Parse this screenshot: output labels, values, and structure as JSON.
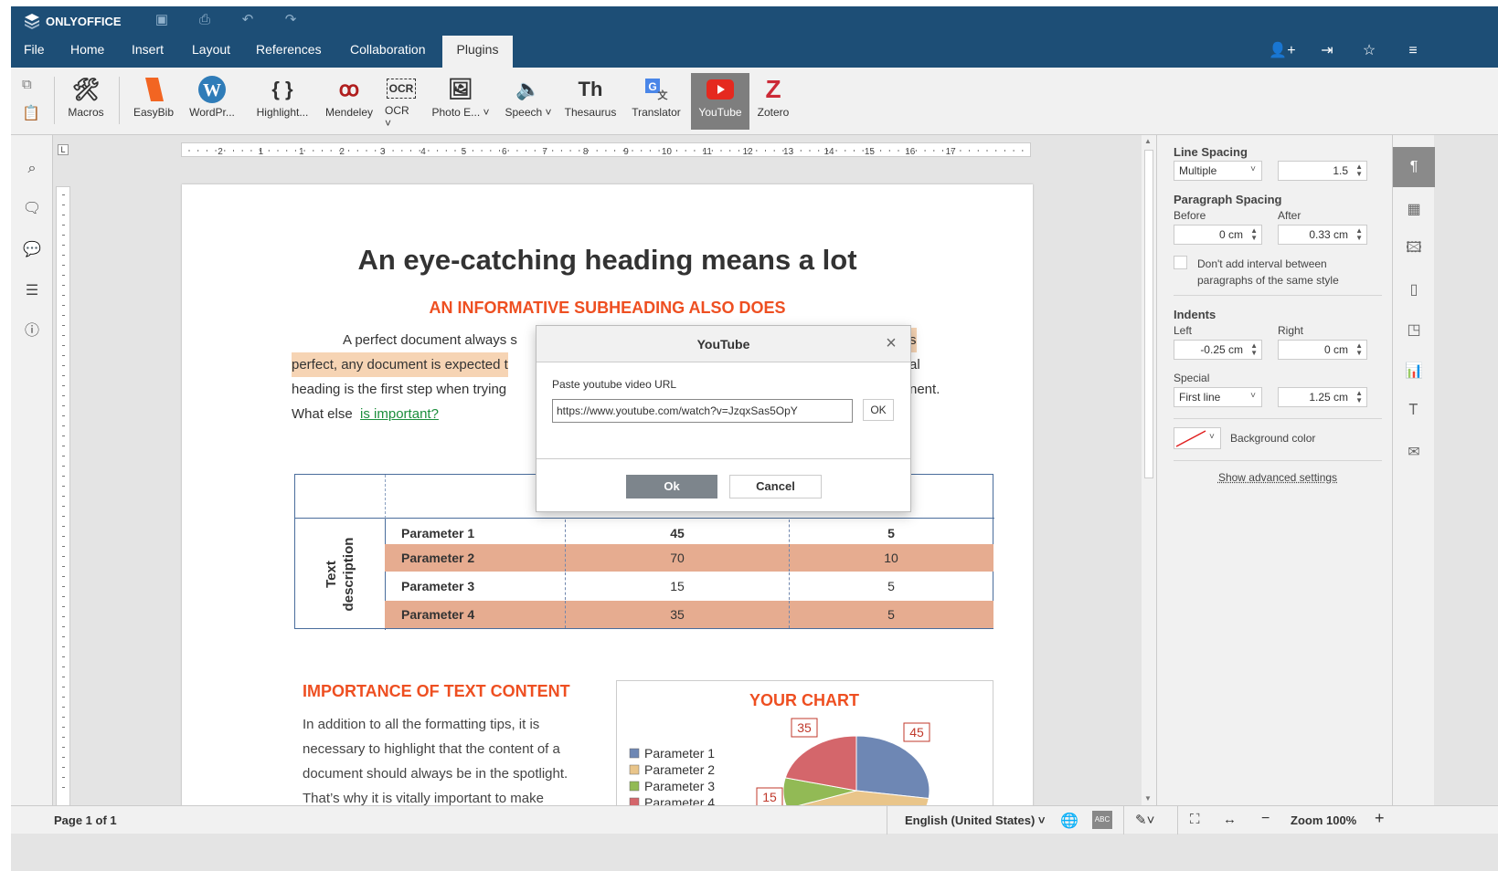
{
  "app": {
    "brand": "ONLYOFFICE"
  },
  "menu": {
    "tabs": [
      "File",
      "Home",
      "Insert",
      "Layout",
      "References",
      "Collaboration",
      "Plugins"
    ],
    "active": "Plugins"
  },
  "ribbon": {
    "items": [
      {
        "label": "Macros",
        "icon": "macros-icon"
      },
      {
        "label": "EasyBib",
        "icon": "easybib-icon"
      },
      {
        "label": "WordPr...",
        "icon": "wordpress-icon"
      },
      {
        "label": "Highlight...",
        "icon": "code-braces-icon"
      },
      {
        "label": "Mendeley",
        "icon": "mendeley-icon"
      },
      {
        "label": "OCR",
        "icon": "ocr-icon"
      },
      {
        "label": "Photo E...",
        "icon": "photo-editor-icon"
      },
      {
        "label": "Speech",
        "icon": "speaker-icon"
      },
      {
        "label": "Thesaurus",
        "icon": "thesaurus-icon"
      },
      {
        "label": "Translator",
        "icon": "translator-icon"
      },
      {
        "label": "YouTube",
        "icon": "youtube-icon"
      },
      {
        "label": "Zotero",
        "icon": "zotero-icon"
      }
    ],
    "ocr_glyph": "OCR",
    "thesaurus_glyph": "Th",
    "zotero_glyph": "Z"
  },
  "ruler": {
    "marks": [
      "2",
      "1",
      "1",
      "2",
      "3",
      "4",
      "5",
      "6",
      "7",
      "8",
      "9",
      "10",
      "11",
      "12",
      "13",
      "14",
      "15",
      "16",
      "17"
    ]
  },
  "document": {
    "heading": "An eye-catching heading means a lot",
    "subheading": "AN INFORMATIVE SUBHEADING ALSO DOES",
    "para_line1_start": "A perfect document always s",
    "para_line1_end": "s",
    "para_line2_start": "perfect, any document is expected t",
    "para_line2_end": "al",
    "para_line3_start": "heading is the first step when trying",
    "para_line3_end": "nent.",
    "para_line4": "What else",
    "para_link": "is important?",
    "table": {
      "side_label": "Text description",
      "rows": [
        {
          "name": "Parameter 1",
          "v1": "45",
          "v2": "5"
        },
        {
          "name": "Parameter 2",
          "v1": "70",
          "v2": "10"
        },
        {
          "name": "Parameter 3",
          "v1": "15",
          "v2": "5"
        },
        {
          "name": "Parameter 4",
          "v1": "35",
          "v2": "5"
        }
      ]
    },
    "section_title": "IMPORTANCE OF TEXT CONTENT",
    "section_lines": [
      "In addition to all the formatting tips, it is",
      "necessary to highlight that the content of a",
      "document should always be in the spotlight.",
      "That’s why it is vitally important to make"
    ]
  },
  "chart_data": {
    "type": "pie",
    "title": "YOUR CHART",
    "categories": [
      "Parameter 1",
      "Parameter 2",
      "Parameter 3",
      "Parameter 4"
    ],
    "values": [
      45,
      70,
      15,
      35
    ],
    "colors": [
      "#6e87b4",
      "#e9c58a",
      "#92ba55",
      "#d4666b"
    ],
    "visible_labels": [
      "35",
      "45",
      "15"
    ]
  },
  "right_panel": {
    "line_spacing_label": "Line Spacing",
    "line_spacing_mode": "Multiple",
    "line_spacing_value": "1.5",
    "paragraph_spacing_label": "Paragraph Spacing",
    "before_label": "Before",
    "after_label": "After",
    "before_value": "0 cm",
    "after_value": "0.33 cm",
    "dont_add_interval": "Don't add interval between paragraphs of the same style",
    "indents_label": "Indents",
    "left_label": "Left",
    "right_label": "Right",
    "left_value": "-0.25 cm",
    "right_value": "0 cm",
    "special_label": "Special",
    "special_mode": "First line",
    "special_value": "1.25 cm",
    "background_color_label": "Background color",
    "advanced_link": "Show advanced settings"
  },
  "status": {
    "page": "Page 1 of 1",
    "language": "English (United States)",
    "zoom": "Zoom 100%"
  },
  "modal": {
    "title": "YouTube",
    "label": "Paste youtube video URL",
    "url_value": "https://www.youtube.com/watch?v=JzqxSas5OpY",
    "inline_ok": "OK",
    "ok": "Ok",
    "cancel": "Cancel"
  },
  "colors": {
    "brand": "#1d4e76",
    "accent_orange": "#ee4f21",
    "table_orange": "#e6ac90",
    "youtube_red": "#e5291f"
  }
}
